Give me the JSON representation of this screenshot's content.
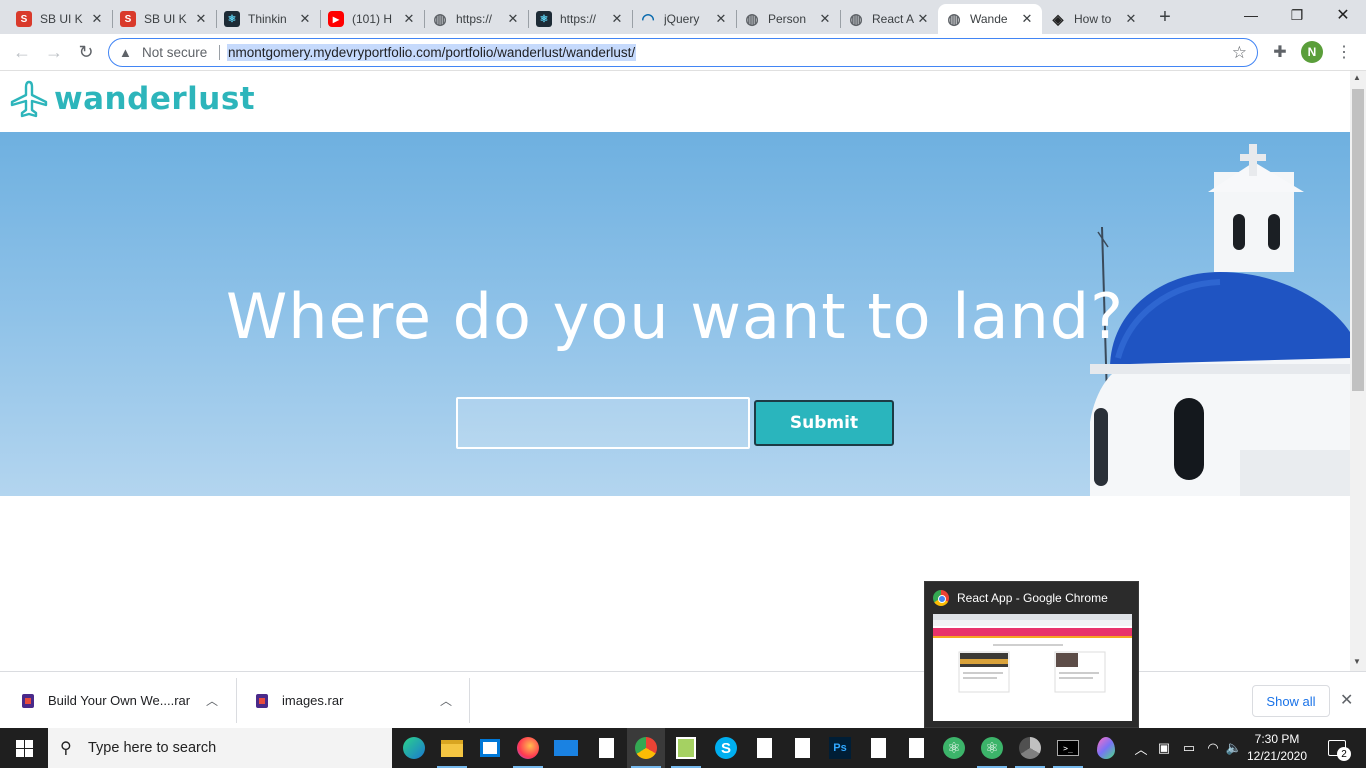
{
  "browser": {
    "tabs": [
      {
        "title": "SB UI K",
        "icon": "s-brand-icon"
      },
      {
        "title": "SB UI K",
        "icon": "s-brand-icon"
      },
      {
        "title": "Thinkin",
        "icon": "react-icon"
      },
      {
        "title": "(101) H",
        "icon": "youtube-icon"
      },
      {
        "title": "https://",
        "icon": "globe-icon"
      },
      {
        "title": "https://",
        "icon": "react-icon"
      },
      {
        "title": "jQuery",
        "icon": "jquery-icon"
      },
      {
        "title": "Person",
        "icon": "globe-icon"
      },
      {
        "title": "React A",
        "icon": "globe-icon"
      },
      {
        "title": "Wande",
        "icon": "globe-icon",
        "active": true
      },
      {
        "title": "How to",
        "icon": "codepen-icon"
      }
    ],
    "not_secure_label": "Not secure",
    "url": "nmontgomery.mydevryportfolio.com/portfolio/wanderlust/wanderlust/",
    "profile_initial": "N"
  },
  "site": {
    "brand": "wanderlust",
    "headline": "Where do you want to land?",
    "search_value": "",
    "submit_label": "Submit",
    "brand_color": "#2db5bb"
  },
  "downloads": {
    "items": [
      {
        "name": "Build Your Own We....rar"
      },
      {
        "name": "images.rar"
      }
    ],
    "show_all_label": "Show all"
  },
  "preview": {
    "title": "React App - Google Chrome"
  },
  "taskbar": {
    "search_placeholder": "Type here to search",
    "time": "7:30 PM",
    "date": "12/21/2020",
    "notifications": "2"
  }
}
